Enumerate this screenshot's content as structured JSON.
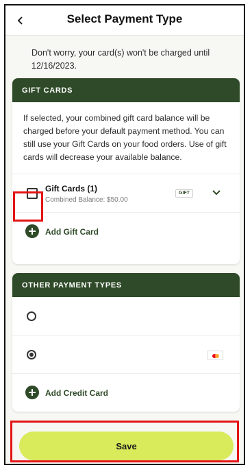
{
  "header": {
    "title": "Select Payment Type",
    "back_icon": "chevron-left-icon"
  },
  "info": {
    "text": "Don't worry, your card(s) won't be charged until 12/16/2023."
  },
  "gift_cards": {
    "section_title": "GIFT CARDS",
    "description": "If selected, your combined gift card balance will be charged before your default payment method. You can still use your Gift Cards on your food orders. Use of gift cards will decrease your available balance.",
    "item": {
      "title": "Gift Cards (1)",
      "subtitle": "Combined Balance: $50.00",
      "badge": "GIFT",
      "checked": false
    },
    "add_label": "Add Gift Card"
  },
  "other_payment": {
    "section_title": "OTHER PAYMENT TYPES",
    "options": [
      {
        "selected": false
      },
      {
        "selected": true,
        "icon": "mastercard-icon"
      }
    ],
    "add_label": "Add Credit Card"
  },
  "actions": {
    "save_label": "Save"
  },
  "colors": {
    "brand_green": "#2f4a28",
    "save_button": "#d9ea5b",
    "highlight": "#e31414"
  }
}
